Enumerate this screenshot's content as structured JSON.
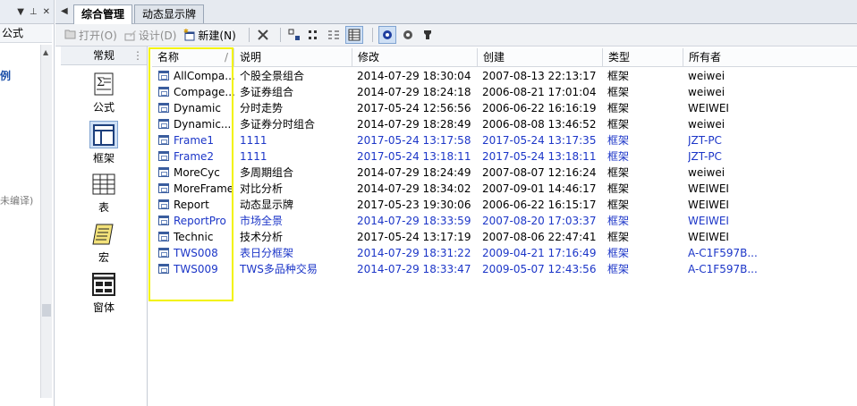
{
  "leftpanel": {
    "tab_label": "公式",
    "link_text": "例",
    "grey_text": "未编译)"
  },
  "tabs": [
    {
      "label": "综合管理",
      "active": true
    },
    {
      "label": "动态显示牌",
      "active": false
    }
  ],
  "toolbar": {
    "open_label": "打开(O)",
    "design_label": "设计(D)",
    "new_label": "新建(N)"
  },
  "categories": {
    "header": "常规",
    "items": [
      {
        "label": "公式",
        "icon": "formula-icon",
        "selected": false
      },
      {
        "label": "框架",
        "icon": "frame-icon",
        "selected": true
      },
      {
        "label": "表",
        "icon": "table-icon",
        "selected": false
      },
      {
        "label": "宏",
        "icon": "macro-scroll-icon",
        "selected": false
      },
      {
        "label": "窗体",
        "icon": "form-icon",
        "selected": false
      }
    ]
  },
  "list": {
    "columns": [
      "名称",
      "说明",
      "修改",
      "创建",
      "类型",
      "所有者"
    ],
    "sort_indicator": "/",
    "rows": [
      {
        "name": "AllCompa...",
        "desc": "个股全景组合",
        "modified": "2014-07-29 18:30:04",
        "created": "2007-08-13 22:13:17",
        "type": "框架",
        "owner": "weiwei",
        "blue": false
      },
      {
        "name": "Compage...",
        "desc": "多证券组合",
        "modified": "2014-07-29 18:24:18",
        "created": "2006-08-21 17:01:04",
        "type": "框架",
        "owner": "weiwei",
        "blue": false
      },
      {
        "name": "Dynamic",
        "desc": "分时走势",
        "modified": "2017-05-24 12:56:56",
        "created": "2006-06-22 16:16:19",
        "type": "框架",
        "owner": "WEIWEI",
        "blue": false
      },
      {
        "name": "Dynamic...",
        "desc": "多证券分时组合",
        "modified": "2014-07-29 18:28:49",
        "created": "2006-08-08 13:46:52",
        "type": "框架",
        "owner": "weiwei",
        "blue": false
      },
      {
        "name": "Frame1",
        "desc": "1111",
        "modified": "2017-05-24 13:17:58",
        "created": "2017-05-24 13:17:35",
        "type": "框架",
        "owner": "JZT-PC",
        "blue": true
      },
      {
        "name": "Frame2",
        "desc": "1111",
        "modified": "2017-05-24 13:18:11",
        "created": "2017-05-24 13:18:11",
        "type": "框架",
        "owner": "JZT-PC",
        "blue": true
      },
      {
        "name": "MoreCyc",
        "desc": "多周期组合",
        "modified": "2014-07-29 18:24:49",
        "created": "2007-08-07 12:16:24",
        "type": "框架",
        "owner": "weiwei",
        "blue": false
      },
      {
        "name": "MoreFrame",
        "desc": "对比分析",
        "modified": "2014-07-29 18:34:02",
        "created": "2007-09-01 14:46:17",
        "type": "框架",
        "owner": "WEIWEI",
        "blue": false
      },
      {
        "name": "Report",
        "desc": "动态显示牌",
        "modified": "2017-05-23 19:30:06",
        "created": "2006-06-22 16:15:17",
        "type": "框架",
        "owner": "WEIWEI",
        "blue": false
      },
      {
        "name": "ReportPro",
        "desc": "市场全景",
        "modified": "2014-07-29 18:33:59",
        "created": "2007-08-20 17:03:37",
        "type": "框架",
        "owner": "WEIWEI",
        "blue": true
      },
      {
        "name": "Technic",
        "desc": "技术分析",
        "modified": "2017-05-24 13:17:19",
        "created": "2007-08-06 22:47:41",
        "type": "框架",
        "owner": "WEIWEI",
        "blue": false
      },
      {
        "name": "TWS008",
        "desc": "表日分框架",
        "modified": "2014-07-29 18:31:22",
        "created": "2009-04-21 17:16:49",
        "type": "框架",
        "owner": "A-C1F597B...",
        "blue": true
      },
      {
        "name": "TWS009",
        "desc": "TWS多品种交易",
        "modified": "2014-07-29 18:33:47",
        "created": "2009-05-07 12:43:56",
        "type": "框架",
        "owner": "A-C1F597B...",
        "blue": true
      }
    ]
  },
  "colors": {
    "blue_row": "#1c36c8",
    "highlight": "#f3f300",
    "selection": "#cfe0f5"
  }
}
